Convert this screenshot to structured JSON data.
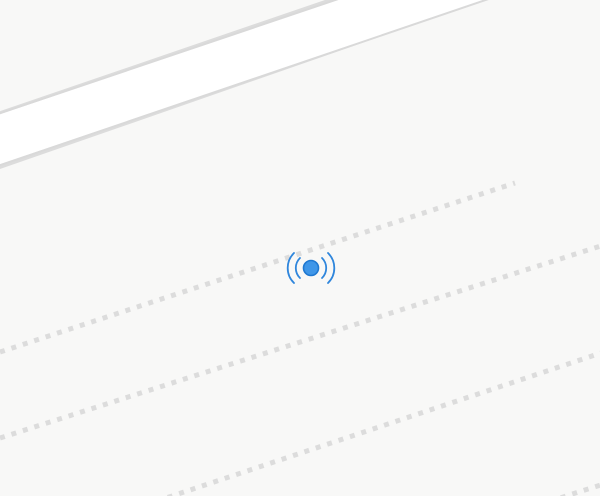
{
  "map": {
    "colors": {
      "background": "#f8f8f7",
      "road_fill": "#ffffff",
      "road_casing": "#dedede",
      "dotted_path": "#dcdcdc",
      "marker_fill": "#3f96e8",
      "marker_stroke": "#1f78d1",
      "signal_arcs": "#2f86dc"
    },
    "features": {
      "main_road": "road",
      "dotted_paths": [
        "dotted-path-1",
        "dotted-path-2",
        "dotted-path-3"
      ],
      "location_marker": "broadcast-location-icon"
    }
  }
}
